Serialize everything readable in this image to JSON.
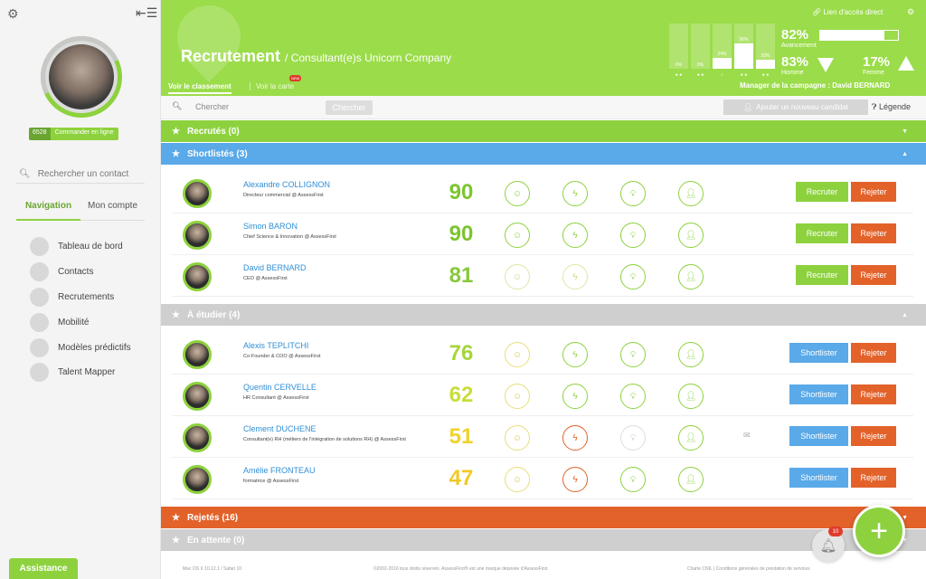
{
  "sidebar": {
    "settings_icon": "gears-icon",
    "collapse_icon": "collapse-menu-icon",
    "credits": "6528",
    "order_label": "Commander en ligne",
    "search_placeholder": "Rechercher un contact",
    "tabs": [
      {
        "label": "Navigation"
      },
      {
        "label": "Mon compte"
      }
    ],
    "nav": [
      {
        "label": "Tableau de bord"
      },
      {
        "label": "Contacts"
      },
      {
        "label": "Recrutements"
      },
      {
        "label": "Mobilité"
      },
      {
        "label": "Modèles prédictifs"
      },
      {
        "label": "Talent Mapper"
      }
    ],
    "assistance": "Assistance"
  },
  "header": {
    "title": "Recrutement",
    "subtitle": "/ Consultant(e)s Unicorn Company",
    "tab_ranking": "Voir le classement",
    "tab_map": "Voir la carte",
    "tab_map_badge": "NEW",
    "direct_link": "Lien d'accès direct",
    "bars": [
      {
        "label": "0%",
        "value": 0
      },
      {
        "label": "0%",
        "value": 0
      },
      {
        "label": "24%",
        "value": 24
      },
      {
        "label": "56%",
        "value": 56
      },
      {
        "label": "20%",
        "value": 20
      }
    ],
    "progress_value": "82%",
    "progress_label": "Avancement",
    "progress_fraction": 0.82,
    "men_value": "83%",
    "men_label": "Homme",
    "women_value": "17%",
    "women_label": "Femme",
    "manager": "Manager de la campagne : David BERNARD"
  },
  "search": {
    "placeholder": "Chercher",
    "button": "Chercher",
    "add_candidate": "Ajouter un nouveau candidat",
    "legend": "Légende"
  },
  "sections": {
    "recruited": {
      "label": "Recrutés (0)",
      "color": "#8dd23e"
    },
    "shortlisted": {
      "label": "Shortlistés (3)",
      "color": "#5aa9e8"
    },
    "studying": {
      "label": "À étudier (4)",
      "color": "#cfcfcf"
    },
    "rejected": {
      "label": "Rejetés (16)",
      "color": "#e2622a"
    },
    "waiting": {
      "label": "En attente (0)",
      "color": "#cfcfcf"
    }
  },
  "shortlisted_candidates": [
    {
      "name": "Alexandre COLLIGNON",
      "role": "Directeur commercial @ AssessFirst",
      "score": "90",
      "primary_action": "Recruter",
      "reject": "Rejeter"
    },
    {
      "name": "Simon BARON",
      "role": "Chief Science & Innovation @ AssessFirst",
      "score": "90",
      "primary_action": "Recruter",
      "reject": "Rejeter"
    },
    {
      "name": "David BERNARD",
      "role": "CEO @ AssessFirst",
      "score": "81",
      "primary_action": "Recruter",
      "reject": "Rejeter"
    }
  ],
  "study_candidates": [
    {
      "name": "Alexis TEPLITCHI",
      "role": "Co-Founder & COO @ AssessFirst",
      "score": "76",
      "primary_action": "Shortlister",
      "reject": "Rejeter"
    },
    {
      "name": "Quentin CERVELLE",
      "role": "HR Consultant @ AssessFirst",
      "score": "62",
      "primary_action": "Shortlister",
      "reject": "Rejeter"
    },
    {
      "name": "Clement DUCHENE",
      "role": "Consultant(e) RH (métiers de l'intégration de solutions RH) @ AssessFirst",
      "score": "51",
      "primary_action": "Shortlister",
      "reject": "Rejeter"
    },
    {
      "name": "Amélie FRONTEAU",
      "role": "formatrice @ AssessFirst",
      "score": "47",
      "primary_action": "Shortlister",
      "reject": "Rejeter"
    }
  ],
  "colors": {
    "green": "#8dd23e",
    "blue": "#5aa9e8",
    "orange": "#e2622a",
    "score_90": "#7cc52e",
    "score_81": "#86c93a",
    "score_76": "#a6d63a",
    "score_62": "#c9dd3a",
    "score_51": "#f0d22b",
    "score_47": "#f2c825"
  },
  "footer": {
    "left": "Mac OS X 10.12.1 / Safari 10",
    "center": "©2002-2016 tous droits réservés. AssessFirst® est une marque déposée d'AssessFirst.",
    "right": "Charte CNIL | Conditions générales de prestation de services"
  },
  "notifications": "10"
}
